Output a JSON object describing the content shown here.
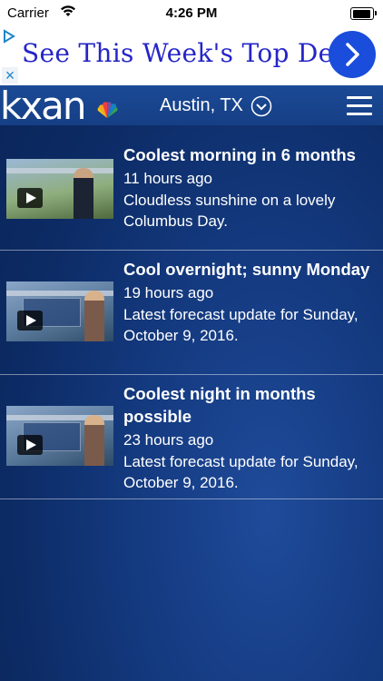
{
  "status_bar": {
    "carrier": "Carrier",
    "time": "4:26 PM",
    "battery_level": 1.0
  },
  "ad": {
    "text": "See This Week's Top Deals",
    "info_icon": "ad-choices-icon",
    "close_icon": "close-icon",
    "go_icon": "chevron-right-icon"
  },
  "header": {
    "logo": "kxan",
    "network_icon": "nbc-peacock-icon",
    "location": "Austin, TX",
    "menu_icon": "hamburger-menu-icon"
  },
  "news": [
    {
      "title": "Coolest morning in 6 months",
      "age": "11 hours ago",
      "description": "Cloudless sunshine on a lovely Columbus Day."
    },
    {
      "title": "Cool overnight; sunny Monday",
      "age": "19 hours ago",
      "description": "Latest forecast update for Sunday, October 9, 2016."
    },
    {
      "title": "Coolest night in months possible",
      "age": "23 hours ago",
      "description": "Latest forecast update for Sunday, October 9, 2016."
    }
  ]
}
